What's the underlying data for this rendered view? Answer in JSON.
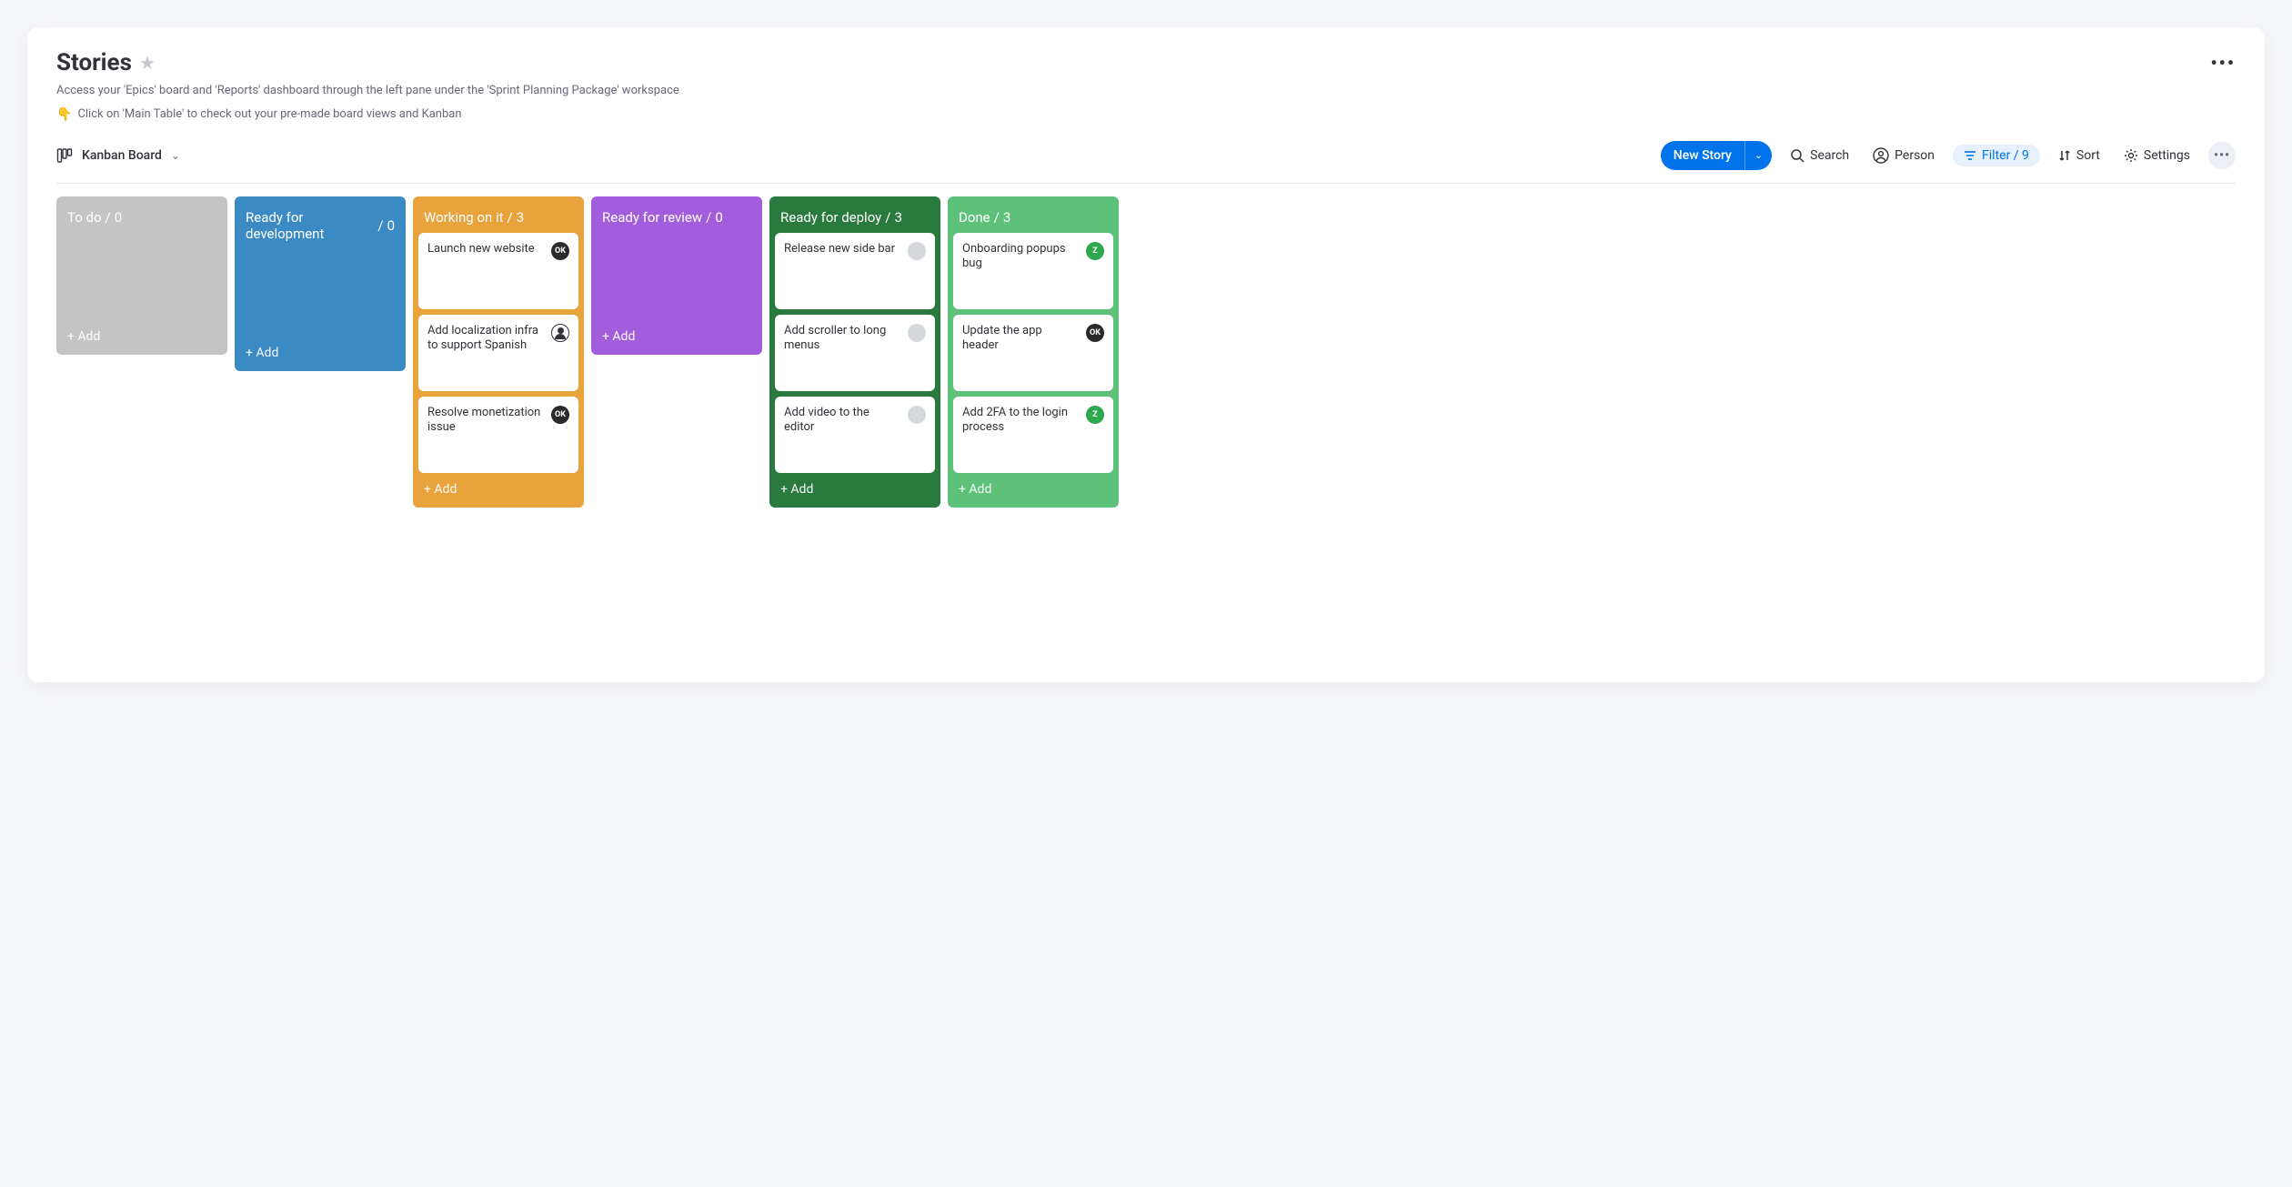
{
  "header": {
    "title": "Stories",
    "subtitle1": "Access your 'Epics' board and 'Reports' dashboard through the left pane under the 'Sprint Planning Package' workspace",
    "subtitle2": "Click on 'Main Table' to check out your pre-made board views and Kanban",
    "pointer_emoji": "👇"
  },
  "toolbar": {
    "view_label": "Kanban Board",
    "new_story": "New Story",
    "search": "Search",
    "person": "Person",
    "filter_label": "Filter / 9",
    "sort": "Sort",
    "settings": "Settings"
  },
  "columns": [
    {
      "id": "todo",
      "title": "To do",
      "count": 0,
      "color_class": "c-todo",
      "cards": [],
      "add_label": "+ Add"
    },
    {
      "id": "ready-dev",
      "title": "Ready for development",
      "count": 0,
      "color_class": "c-ready-dev",
      "cards": [],
      "add_label": "+ Add"
    },
    {
      "id": "working",
      "title": "Working on it",
      "count": 3,
      "color_class": "c-working",
      "cards": [
        {
          "title": "Launch new website",
          "avatar": "ok",
          "avatar_text": "OK"
        },
        {
          "title": "Add localization infra to support Spanish",
          "avatar": "user",
          "avatar_text": ""
        },
        {
          "title": "Resolve monetization issue",
          "avatar": "ok",
          "avatar_text": "OK"
        }
      ],
      "add_label": "+ Add"
    },
    {
      "id": "review",
      "title": "Ready for review",
      "count": 0,
      "color_class": "c-review",
      "cards": [],
      "add_label": "+ Add"
    },
    {
      "id": "deploy",
      "title": "Ready for deploy",
      "count": 3,
      "color_class": "c-deploy",
      "cards": [
        {
          "title": "Release new side bar",
          "avatar": "blank",
          "avatar_text": ""
        },
        {
          "title": "Add scroller to long menus",
          "avatar": "blank",
          "avatar_text": ""
        },
        {
          "title": "Add video to the editor",
          "avatar": "blank",
          "avatar_text": ""
        }
      ],
      "add_label": "+ Add"
    },
    {
      "id": "done",
      "title": "Done",
      "count": 3,
      "color_class": "c-done",
      "cards": [
        {
          "title": "Onboarding popups bug",
          "avatar": "z",
          "avatar_text": "Z"
        },
        {
          "title": "Update the app header",
          "avatar": "ok",
          "avatar_text": "OK"
        },
        {
          "title": "Add 2FA to the login process",
          "avatar": "z",
          "avatar_text": "Z"
        }
      ],
      "add_label": "+ Add"
    }
  ]
}
